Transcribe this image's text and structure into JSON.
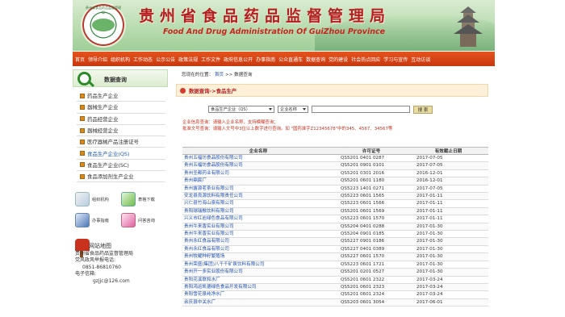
{
  "header": {
    "logo_text": "贵州省食品药品监督管理局",
    "title_cn": "贵州省食品药品监督管理局",
    "title_en": "Food And Drug Administration Of GuiZhou Province"
  },
  "nav": [
    "首页",
    "领导介绍",
    "组织机构",
    "工作动态",
    "公示公告",
    "政策法规",
    "工作文件",
    "政府信息公开",
    "办事指南",
    "公众直通车",
    "数据查询",
    "党的建设",
    "社会热点回应",
    "学习与宣传",
    "互动访谈"
  ],
  "sidebar": {
    "header": "数据查询",
    "items": [
      {
        "label": "药品生产企业"
      },
      {
        "label": "器械生产企业"
      },
      {
        "label": "药品经营企业"
      },
      {
        "label": "器械经营企业"
      },
      {
        "label": "医疗器械产品注册证号"
      },
      {
        "label": "食品生产企业(QS)"
      },
      {
        "label": "食品生产企业(SC)"
      },
      {
        "label": "食品添加剂生产企业"
      }
    ],
    "icons": [
      {
        "label": "组织机构",
        "icon": "org-icon"
      },
      {
        "label": "表格下载",
        "icon": "download-icon"
      },
      {
        "label": "办事指南",
        "icon": "guide-icon"
      },
      {
        "label": "问答咨询",
        "icon": "qa-icon"
      }
    ],
    "map_label": "网站地图",
    "contact": [
      "贵州省食品药品监督管理局",
      "党风政风举报电话:",
      "0851-86810760",
      "电子信箱:",
      "gzjjc@126.com"
    ]
  },
  "main": {
    "location_prefix": "您现在的位置：",
    "location_home": "首页",
    "location_sep": ">>",
    "location_current": "数据查询",
    "title": "数据查询->食品生产",
    "select_type": "食品生产企业（QS）",
    "select_field": "企业名称",
    "search_button": "搜 索",
    "hint1": "企业信息查询：请输入企业名称，支持模糊查询；",
    "hint2": "批准文号查询：请输入文号中3位以上数字进行查询。如 \"国药准字Z12345678\"中的345、4567、34567等",
    "table": {
      "headers": [
        "企业名称",
        "许可证号",
        "有效截止日期"
      ],
      "rows": [
        [
          "贵州五福坊食品股份有限公司",
          "QS5201 0401 0287",
          "2017-07-05"
        ],
        [
          "贵州五福坊食品股份有限公司",
          "QS5201 0901 0101",
          "2017-07-05"
        ],
        [
          "贵州圣都药业有限公司",
          "QS5201 0301 2016",
          "2016-12-01"
        ],
        [
          "贵州鼎宸厂",
          "QS5201 0601 1180",
          "2016-12-01"
        ],
        [
          "贵州露源茗茶业有限公司",
          "QS5223 1401 0271",
          "2017-07-05"
        ],
        [
          "安龙县良源饮料有限责任公司",
          "QS5223 0601 1565",
          "2017-01-11"
        ],
        [
          "兴仁县竹海山泉有限公司",
          "QS5223 0601 1566",
          "2017-01-11"
        ],
        [
          "贵阳球瑞融饮料有限公司",
          "QS5201 0601 1569",
          "2017-01-11"
        ],
        [
          "兴义市红岩绿色食品有限公司",
          "QS5223 0601 1570",
          "2017-01-11"
        ],
        [
          "贵州牛来香实业有限公司",
          "QS5204 0401 0288",
          "2017-01-30"
        ],
        [
          "贵州牛来香实业有限公司",
          "QS5204 0901 0185",
          "2017-01-30"
        ],
        [
          "贵州永红食品有限公司",
          "QS5227 0901 0186",
          "2017-01-30"
        ],
        [
          "贵州永红食品有限公司",
          "QS5227 0401 0389",
          "2017-01-30"
        ],
        [
          "贵州牧耀种籽繁殖场",
          "QS5227 0601 1570",
          "2017-01-30"
        ],
        [
          "贵州荣盛(集团)八千千矿泉饮料有限公司",
          "QS5223 0601 1721",
          "2017-01-30"
        ],
        [
          "贵州开一多实业股份有限公司",
          "QS5201 0201 0527",
          "2017-01-30"
        ],
        [
          "贵阳花溪联和水厂",
          "QS5201 0601 2322",
          "2017-03-24"
        ],
        [
          "贵阳鸿运凯德绿色食品开发有限公司",
          "QS5201 0601 2323",
          "2017-03-24"
        ],
        [
          "贵阳雪花泉纯净水厂",
          "QS5201 0601 2324",
          "2017-03-24"
        ],
        [
          "余庆县中关水厂",
          "QS5203 0601 3054",
          "2017-06-01"
        ]
      ]
    }
  },
  "colors": {
    "nav": "#d9461a",
    "title_red": "#b31f1f",
    "link_blue": "#1d4fae"
  }
}
